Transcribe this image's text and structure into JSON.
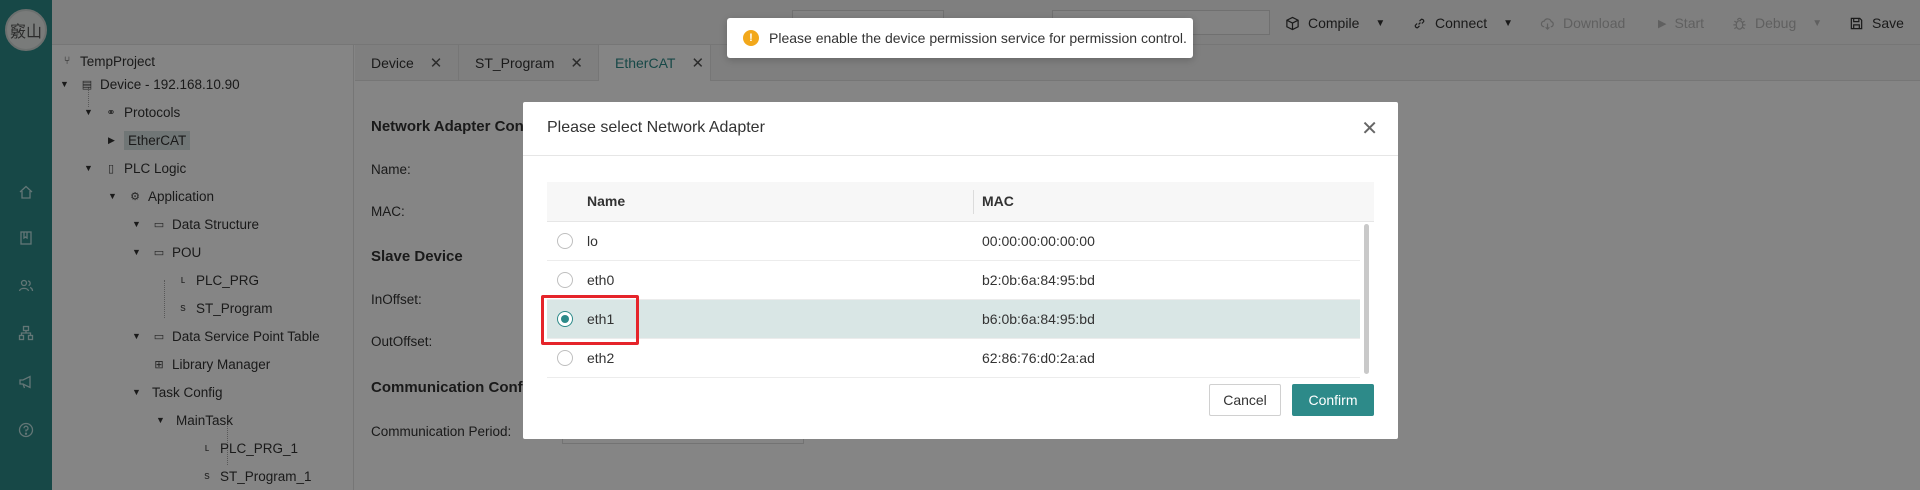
{
  "app": {
    "logo_text": "竅山",
    "accent_color": "#2d8a89"
  },
  "rail": {
    "icons": [
      "home-icon",
      "book-icon",
      "users-icon",
      "sitemap-icon",
      "megaphone-icon",
      "help-icon"
    ]
  },
  "toolbar": {
    "compile": "Compile",
    "connect": "Connect",
    "download": "Download",
    "start": "Start",
    "debug": "Debug",
    "save": "Save"
  },
  "toast": {
    "message": "Please enable the device permission service for permission control."
  },
  "tree": {
    "project": "TempProject",
    "device": "Device - 192.168.10.90",
    "protocols": "Protocols",
    "ethercat": "EtherCAT",
    "plc_logic": "PLC Logic",
    "application": "Application",
    "data_structure": "Data Structure",
    "pou": "POU",
    "plc_prg": "PLC_PRG",
    "st_program": "ST_Program",
    "data_service": "Data Service Point Table",
    "library_manager": "Library Manager",
    "task_config": "Task Config",
    "main_task": "MainTask",
    "plc_prg_1": "PLC_PRG_1",
    "st_program_1": "ST_Program_1"
  },
  "tabs": [
    {
      "label": "Device",
      "active": false
    },
    {
      "label": "ST_Program",
      "active": false
    },
    {
      "label": "EtherCAT",
      "active": true
    }
  ],
  "content": {
    "network_adapter_title": "Network Adapter Con",
    "name_label": "Name:",
    "mac_label": "MAC:",
    "slave_device_title": "Slave Device",
    "inoffset_label": "InOffset:",
    "outoffset_label": "OutOffset:",
    "comm_title": "Communication Conf",
    "comm_period_label": "Communication Period:"
  },
  "modal": {
    "title": "Please select Network Adapter",
    "columns": [
      "Name",
      "MAC"
    ],
    "rows": [
      {
        "name": "lo",
        "mac": "00:00:00:00:00:00",
        "selected": false
      },
      {
        "name": "eth0",
        "mac": "b2:0b:6a:84:95:bd",
        "selected": false
      },
      {
        "name": "eth1",
        "mac": "b6:0b:6a:84:95:bd",
        "selected": true
      },
      {
        "name": "eth2",
        "mac": "62:86:76:d0:2a:ad",
        "selected": false
      }
    ],
    "cancel": "Cancel",
    "confirm": "Confirm"
  }
}
